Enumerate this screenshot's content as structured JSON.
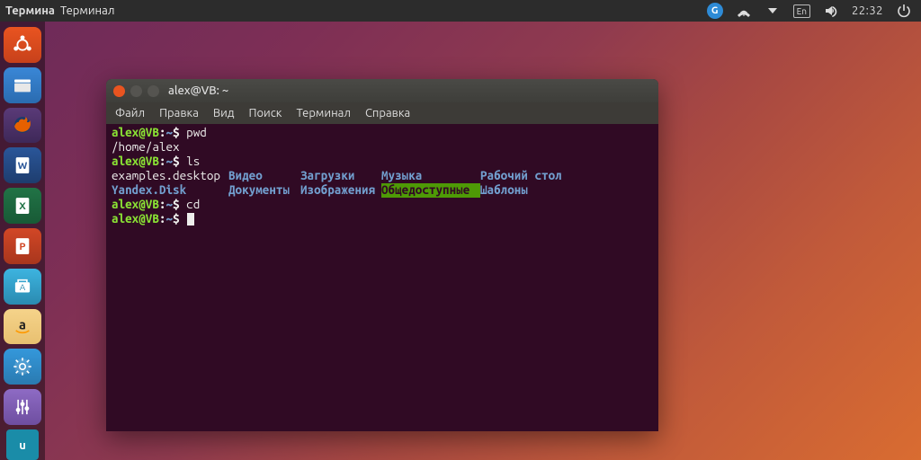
{
  "top_panel": {
    "app_label_bold": "Термина",
    "app_label_normal": "Терминал",
    "language": "En",
    "time": "22:32"
  },
  "launcher": {
    "items": [
      {
        "name": "ubuntu-dash"
      },
      {
        "name": "files"
      },
      {
        "name": "firefox"
      },
      {
        "name": "libreoffice-writer"
      },
      {
        "name": "libreoffice-calc"
      },
      {
        "name": "libreoffice-impress"
      },
      {
        "name": "ubuntu-software"
      },
      {
        "name": "amazon"
      },
      {
        "name": "system-settings"
      },
      {
        "name": "sound-mixer"
      },
      {
        "name": "usb-device"
      }
    ]
  },
  "terminal": {
    "title": "alex@VB: ~",
    "menus": [
      "Файл",
      "Правка",
      "Вид",
      "Поиск",
      "Терминал",
      "Справка"
    ],
    "prompt": {
      "user_host": "alex@VB",
      "path": "~",
      "sep1": ":",
      "sep2": "$ "
    },
    "lines": [
      {
        "type": "cmd",
        "cmd": "pwd"
      },
      {
        "type": "out",
        "text": "/home/alex"
      },
      {
        "type": "cmd",
        "cmd": "ls"
      },
      {
        "type": "ls"
      },
      {
        "type": "cmd",
        "cmd": "cd"
      },
      {
        "type": "prompt_cursor"
      }
    ],
    "ls_items": [
      {
        "text": "examples.desktop",
        "cls": "file"
      },
      {
        "text": "Видео",
        "cls": "dir"
      },
      {
        "text": "Загрузки",
        "cls": "dir"
      },
      {
        "text": "Музыка",
        "cls": "dir"
      },
      {
        "text": "Рабочий стол",
        "cls": "dir"
      },
      {
        "text": "Yandex.Disk",
        "cls": "dir"
      },
      {
        "text": "Документы",
        "cls": "dir"
      },
      {
        "text": "Изображения",
        "cls": "dir"
      },
      {
        "text": "Общедоступные",
        "cls": "hl"
      },
      {
        "text": "Шаблоны",
        "cls": "dir"
      }
    ]
  }
}
